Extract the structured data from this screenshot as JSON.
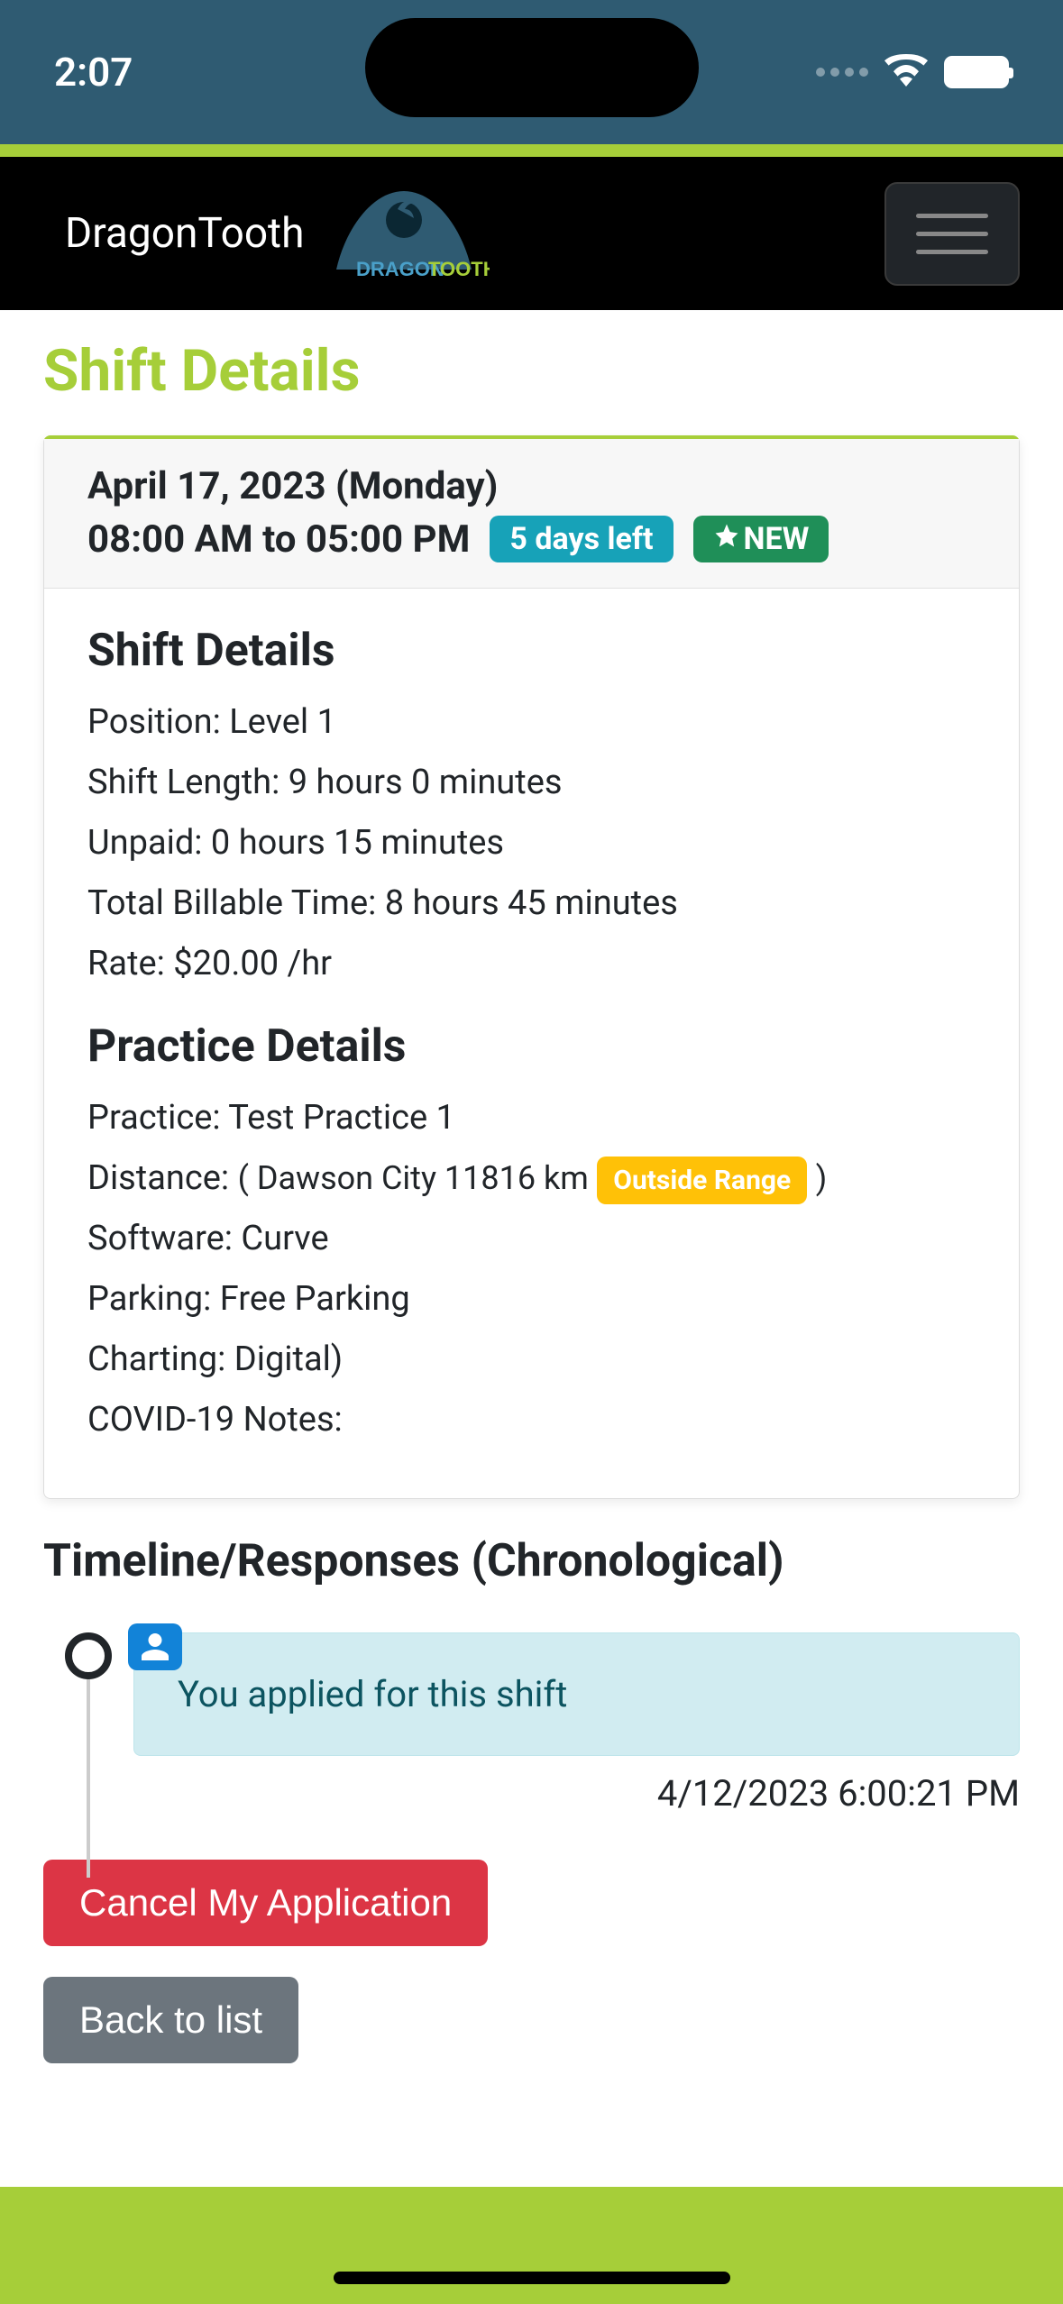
{
  "status_bar": {
    "time": "2:07"
  },
  "navbar": {
    "brand": "DragonTooth",
    "logo_text_a": "DRAGON",
    "logo_text_b": "TOOTH"
  },
  "page": {
    "title": "Shift Details"
  },
  "card": {
    "date": "April 17, 2023 (Monday)",
    "time": "08:00 AM to 05:00 PM",
    "badge_days": "5 days left",
    "badge_new": "NEW"
  },
  "shift_details": {
    "heading": "Shift Details",
    "position": "Position: Level 1",
    "length": "Shift Length: 9 hours 0 minutes",
    "unpaid": "Unpaid: 0 hours 15 minutes",
    "billable": "Total Billable Time: 8 hours 45 minutes",
    "rate": "Rate: $20.00 /hr"
  },
  "practice_details": {
    "heading": "Practice Details",
    "practice": "Practice: Test Practice 1",
    "distance_label": "Distance:",
    "distance_paren_open": "( Dawson City 11816 km",
    "distance_badge": "Outside Range",
    "distance_paren_close": ")",
    "software": "Software: Curve",
    "parking": "Parking: Free Parking",
    "charting": "Charting: Digital)",
    "covid": "COVID-19 Notes:"
  },
  "timeline": {
    "heading": "Timeline/Responses (Chronological)",
    "message": "You applied for this shift",
    "timestamp": "4/12/2023 6:00:21 PM"
  },
  "buttons": {
    "cancel": "Cancel My Application",
    "back": "Back to list"
  }
}
